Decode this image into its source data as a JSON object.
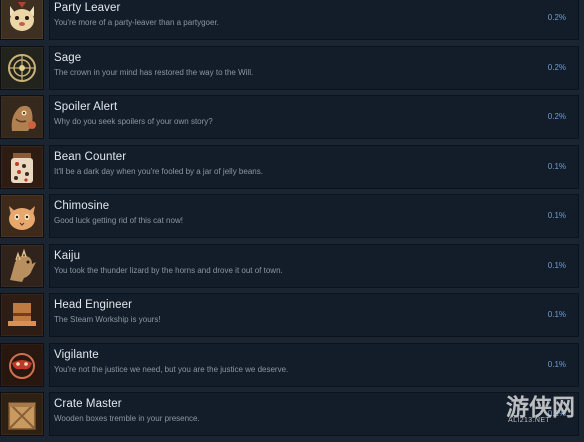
{
  "achievements": [
    {
      "name": "Party Leaver",
      "desc": "You're more of a party-leaver than a partygoer.",
      "pct": "0.2%",
      "icon": "party-hamster-icon",
      "icon_bg": "#4a3a26"
    },
    {
      "name": "Sage",
      "desc": "The crown in your mind has restored the way to the Will.",
      "pct": "0.2%",
      "icon": "golden-crown-emblem-icon",
      "icon_bg": "#2a2a22"
    },
    {
      "name": "Spoiler Alert",
      "desc": "Why do you seek spoilers of your own story?",
      "pct": "0.2%",
      "icon": "spoiler-creature-icon",
      "icon_bg": "#3c2c22"
    },
    {
      "name": "Bean Counter",
      "desc": "It'll be a dark day when you're fooled by a jar of jelly beans.",
      "pct": "0.1%",
      "icon": "jelly-bean-jar-icon",
      "icon_bg": "#3a2318"
    },
    {
      "name": "Chimosine",
      "desc": "Good luck getting rid of this cat now!",
      "pct": "0.1%",
      "icon": "cat-face-icon",
      "icon_bg": "#4b3321"
    },
    {
      "name": "Kaiju",
      "desc": "You took the thunder lizard by the horns and drove it out of town.",
      "pct": "0.1%",
      "icon": "kaiju-lizard-icon",
      "icon_bg": "#3a2a20"
    },
    {
      "name": "Head Engineer",
      "desc": "The Steam Workship is yours!",
      "pct": "0.1%",
      "icon": "engineer-hat-icon",
      "icon_bg": "#3a2418"
    },
    {
      "name": "Vigilante",
      "desc": "You're not the justice we need, but you are the justice we deserve.",
      "pct": "0.1%",
      "icon": "vigilante-mask-icon",
      "icon_bg": "#2f1c18"
    },
    {
      "name": "Crate Master",
      "desc": "Wooden boxes tremble in your presence.",
      "pct": "0.1%",
      "icon": "wooden-crate-icon",
      "icon_bg": "#3b2818"
    }
  ],
  "watermark": {
    "text": "游侠网",
    "sub": "ALI213.NET"
  }
}
